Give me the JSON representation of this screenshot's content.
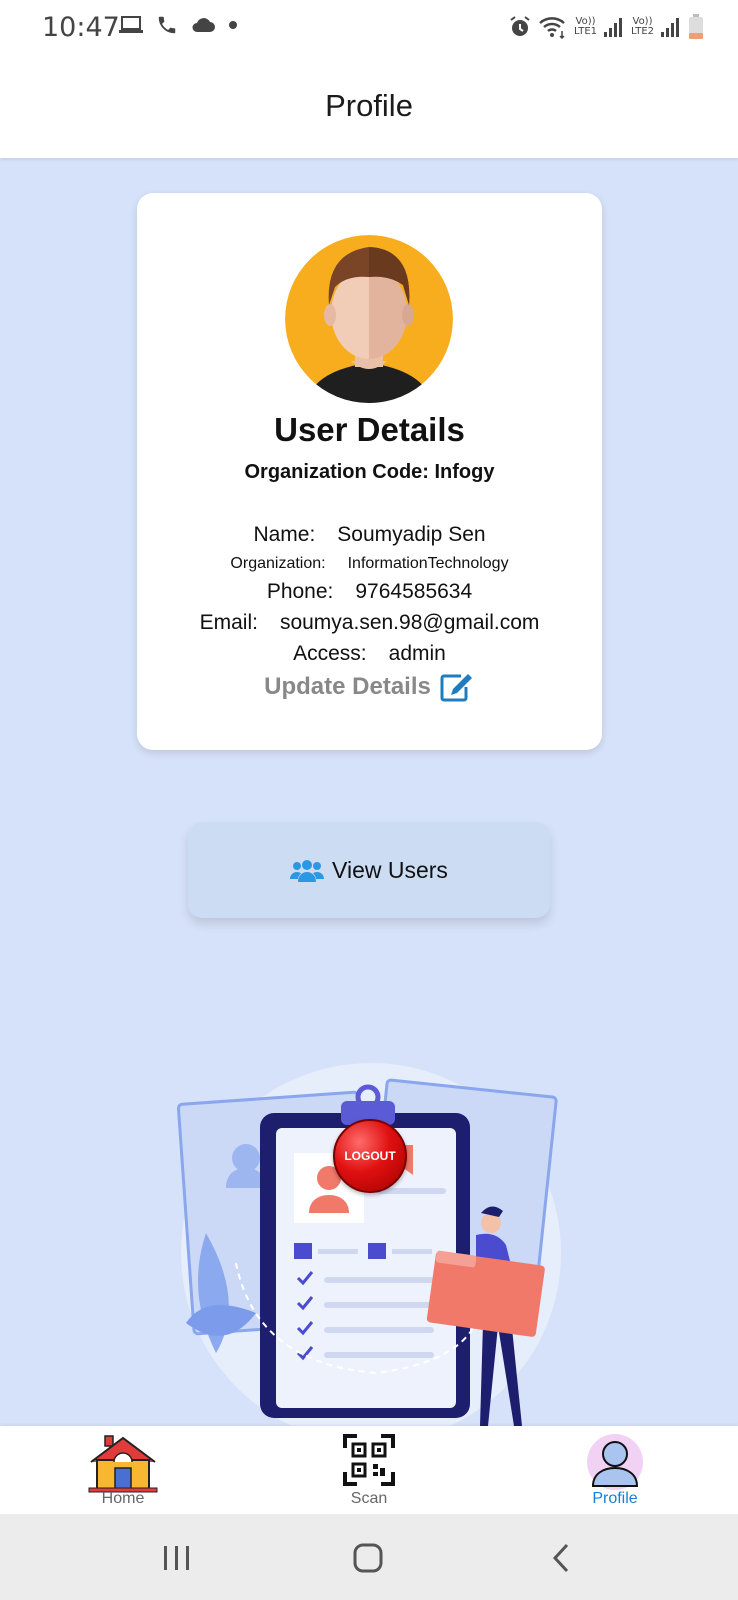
{
  "status_bar": {
    "time": "10:47",
    "net1": "Vo))\nLTE1",
    "net2": "Vo))\nLTE2"
  },
  "appbar": {
    "title": "Profile"
  },
  "card": {
    "title": "User Details",
    "org_code": "Organization Code: Infogy",
    "name_label": "Name:",
    "name_value": "Soumyadip Sen",
    "org_label": "Organization:",
    "org_value": "InformationTechnology",
    "phone_label": "Phone:",
    "phone_value": "9764585634",
    "email_label": "Email:",
    "email_value": "soumya.sen.98@gmail.com",
    "access_label": "Access:",
    "access_value": "admin",
    "update_label": "Update Details"
  },
  "view_users": {
    "label": "View Users"
  },
  "logout": {
    "label": "LOGOUT"
  },
  "bottom_nav": {
    "items": [
      {
        "label": "Home",
        "icon": "home-icon"
      },
      {
        "label": "Scan",
        "icon": "qr-scan-icon"
      },
      {
        "label": "Profile",
        "icon": "profile-icon",
        "active": true
      }
    ]
  },
  "colors": {
    "background": "#d6e2f9",
    "accent": "#1a7fd4",
    "avatar_bg": "#f7ad1e",
    "logout": "#e01010"
  }
}
